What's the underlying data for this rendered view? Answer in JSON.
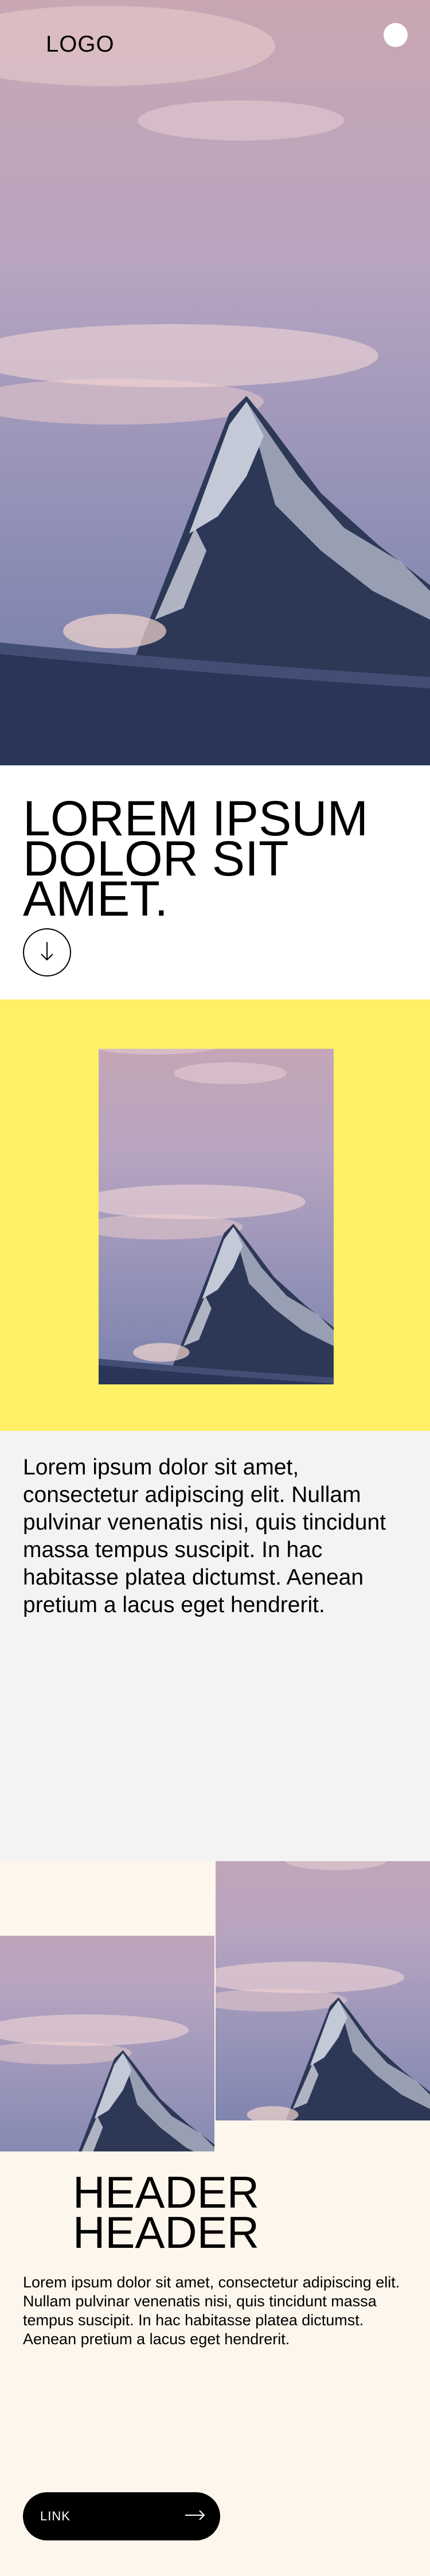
{
  "header": {
    "logo": "LOGO"
  },
  "hero": {
    "image": "mountain-peak-photo"
  },
  "intro": {
    "title": "LOREM IPSUM DOLOR SIT AMET."
  },
  "feature": {
    "image": "mountain-peak-photo"
  },
  "body": {
    "paragraph": "Lorem ipsum dolor sit amet, consectetur adipiscing elit. Nullam pulvinar venenatis nisi, quis tincidunt massa tempus suscipit. In hac habitasse platea dictumst. Aenean pretium a lacus eget hendrerit."
  },
  "gallery": {
    "header": "HEADER HEADER",
    "paragraph": "Lorem ipsum dolor sit amet, consectetur adipiscing elit. Nullam pulvinar venenatis nisi, quis tincidunt massa tempus suscipit. In hac habitasse platea dictumst. Aenean pretium a lacus eget hendrerit.",
    "link_label": "LINK"
  },
  "colors": {
    "accent_yellow": "#fff066",
    "grey_bg": "#f3f3f3",
    "cream_bg": "#fdf6ec",
    "button_bg": "#000000"
  },
  "icons": {
    "scroll": "arrow-down-icon",
    "link": "arrow-right-icon",
    "menu": "menu-dot-icon"
  }
}
